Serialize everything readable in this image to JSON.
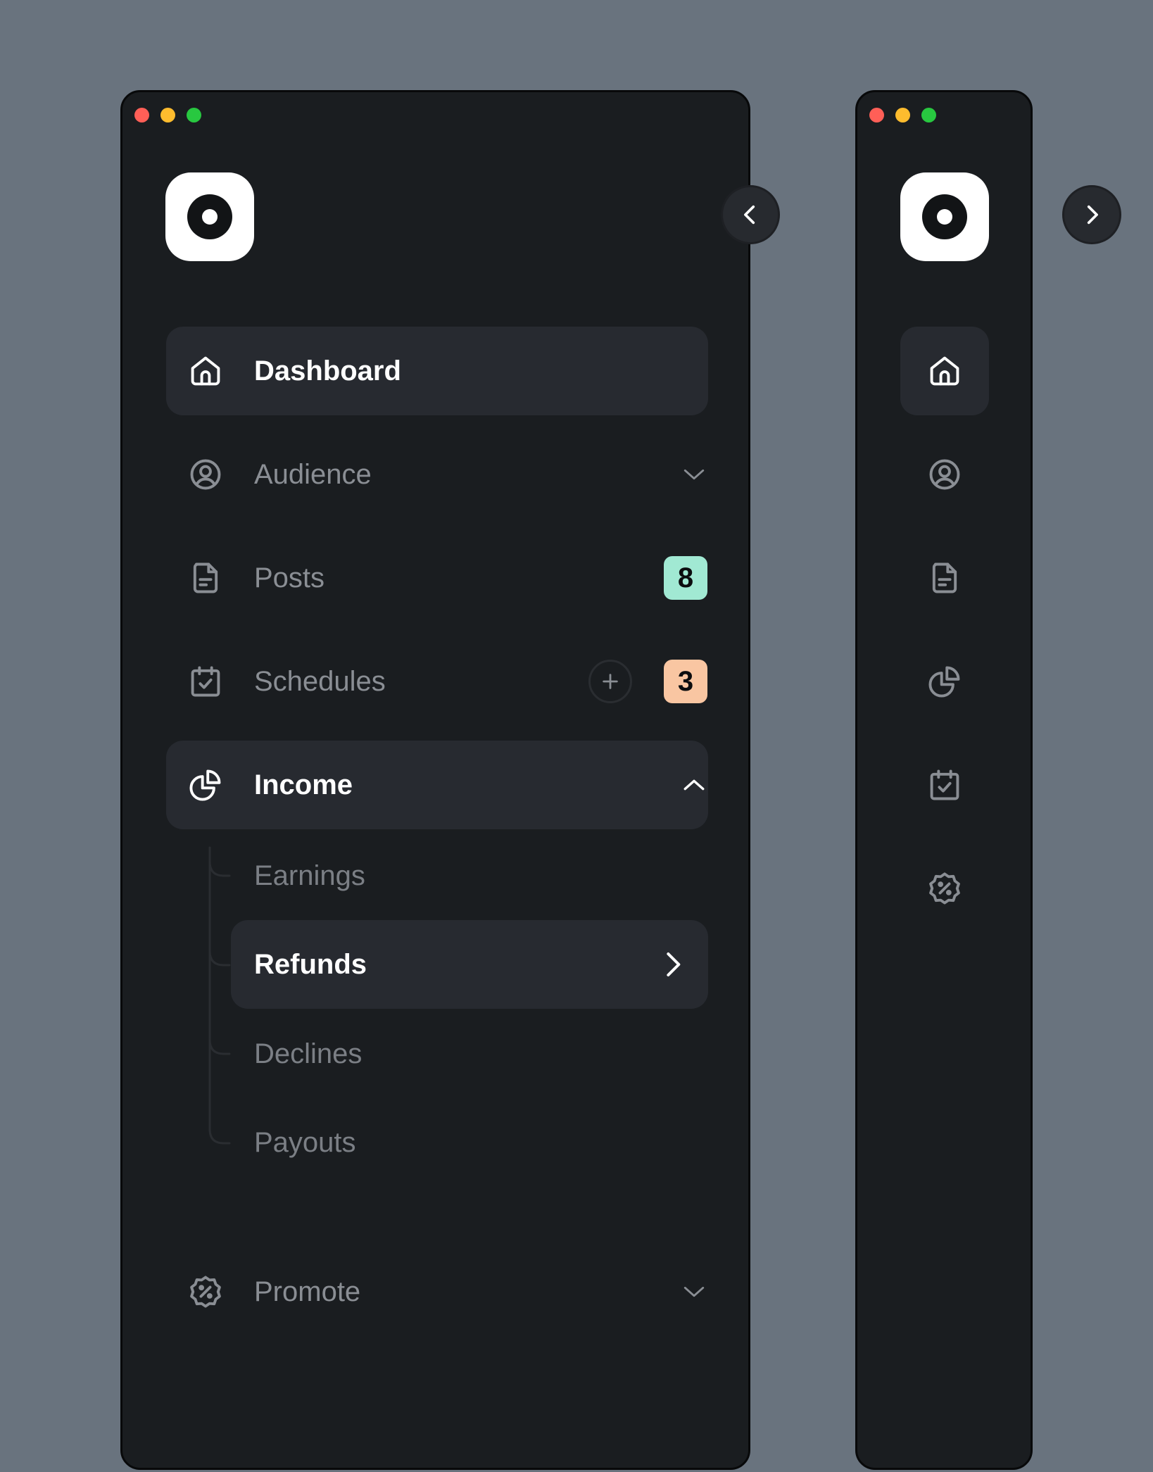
{
  "colors": {
    "background": "#69737e",
    "panel": "#1a1d20",
    "active_item": "#272a30",
    "text_active": "#ffffff",
    "text_muted": "#8a8e94",
    "dot_red": "#ff5f57",
    "dot_yellow": "#febc2e",
    "dot_green": "#28c840",
    "badge_posts": "#a1e9d3",
    "badge_schedules": "#f9c6a2"
  },
  "expanded": {
    "nav": {
      "dashboard": {
        "label": "Dashboard",
        "icon": "home-icon"
      },
      "audience": {
        "label": "Audience",
        "icon": "user-circle-icon"
      },
      "posts": {
        "label": "Posts",
        "icon": "document-icon",
        "badge": "8"
      },
      "schedules": {
        "label": "Schedules",
        "icon": "calendar-check-icon",
        "badge": "3"
      },
      "income": {
        "label": "Income",
        "icon": "pie-chart-icon",
        "children": [
          "Earnings",
          "Refunds",
          "Declines",
          "Payouts"
        ]
      },
      "promote": {
        "label": "Promote",
        "icon": "discount-badge-icon"
      }
    }
  },
  "collapsed": {
    "icons": [
      "home-icon",
      "user-circle-icon",
      "document-icon",
      "pie-chart-icon",
      "calendar-check-icon",
      "discount-badge-icon"
    ]
  }
}
